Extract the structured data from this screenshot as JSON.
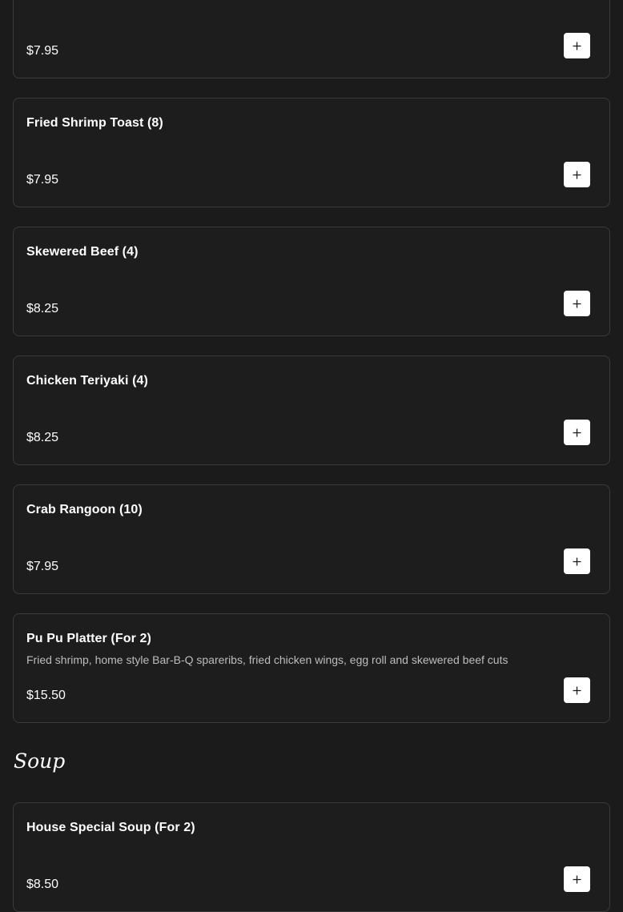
{
  "appetizers": {
    "items": [
      {
        "name": "",
        "description": "",
        "price": "$7.95"
      },
      {
        "name": "Fried Shrimp Toast (8)",
        "description": "",
        "price": "$7.95"
      },
      {
        "name": "Skewered Beef (4)",
        "description": "",
        "price": "$8.25"
      },
      {
        "name": "Chicken Teriyaki (4)",
        "description": "",
        "price": "$8.25"
      },
      {
        "name": "Crab Rangoon (10)",
        "description": "",
        "price": "$7.95"
      },
      {
        "name": "Pu Pu Platter (For 2)",
        "description": "Fried shrimp, home style Bar-B-Q spareribs, fried chicken wings, egg roll and skewered beef cuts",
        "price": "$15.50"
      }
    ]
  },
  "soup": {
    "title": "Soup",
    "items": [
      {
        "name": "House Special Soup (For 2)",
        "description": "",
        "price": "$8.50"
      }
    ]
  },
  "icons": {
    "add": "plus-icon"
  },
  "colors": {
    "background": "#1b1b1b",
    "card_border": "#3a3a3a",
    "button_bg": "#ffffff",
    "text": "#ffffff",
    "muted_text": "#bdbdbd"
  }
}
